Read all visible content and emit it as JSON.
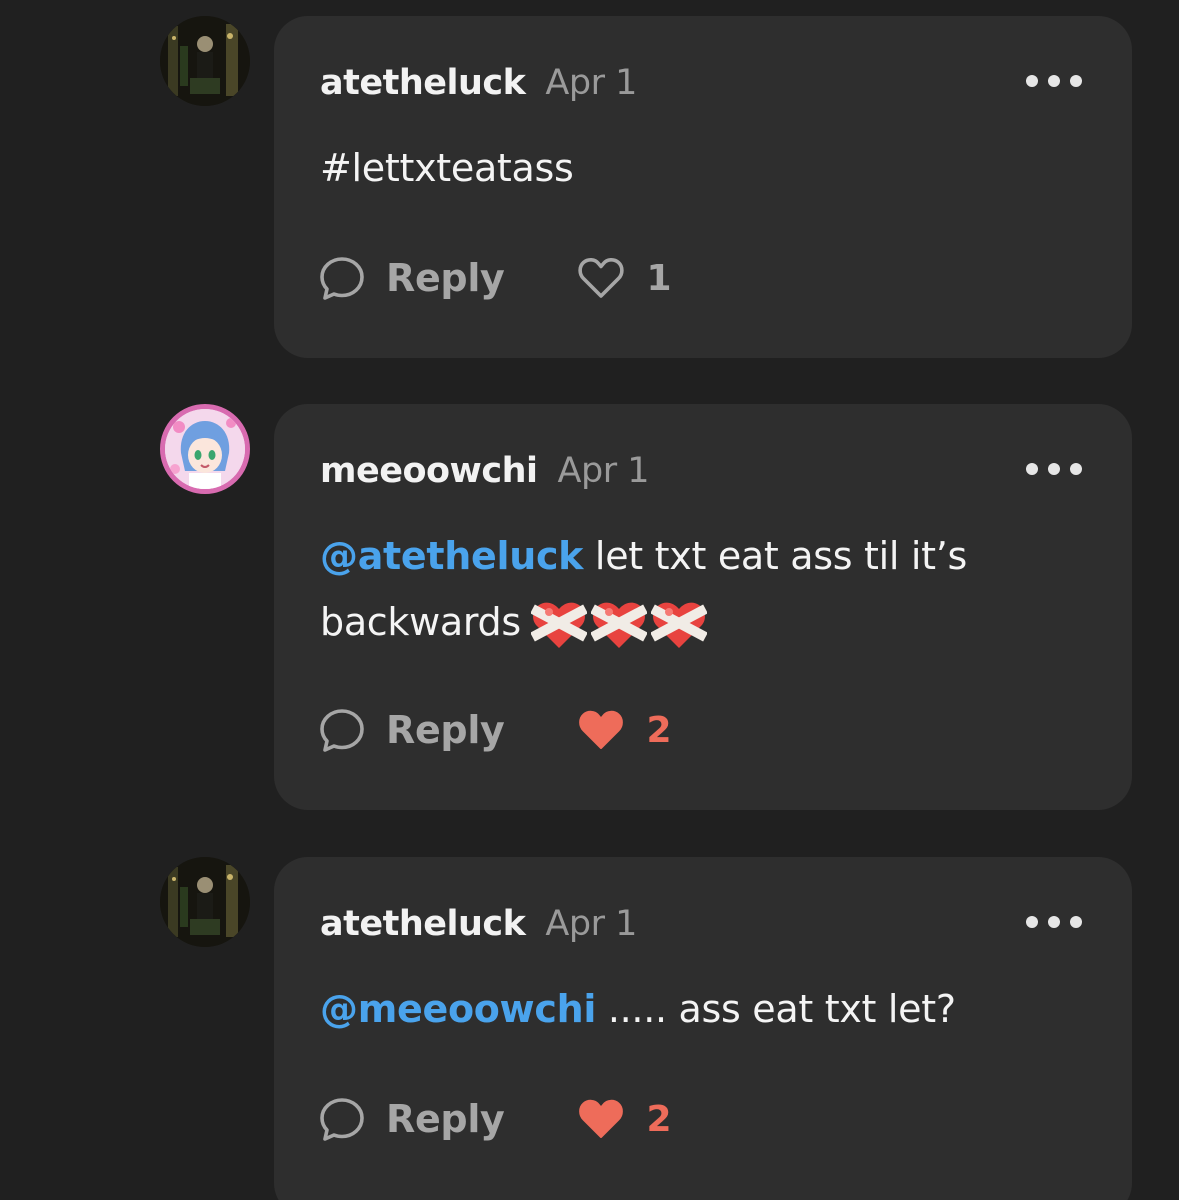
{
  "colors": {
    "background": "#202020",
    "card": "#2e2e2e",
    "mention": "#4aa3ec",
    "liked": "#ee6c5a",
    "muted": "#9a9a9a"
  },
  "comments": [
    {
      "username": "atetheluck",
      "date": "Apr 1",
      "text": "#lettxteatass",
      "reply_label": "Reply",
      "like_count": "1",
      "liked": false,
      "avatar_icon": "avatar-dark-photo"
    },
    {
      "username": "meeoowchi",
      "date": "Apr 1",
      "mention": "@atetheluck",
      "text": " let txt eat ass til it’s backwards",
      "emojis": [
        "mending-heart-emoji",
        "mending-heart-emoji",
        "mending-heart-emoji"
      ],
      "reply_label": "Reply",
      "like_count": "2",
      "liked": true,
      "avatar_icon": "avatar-anime-character"
    },
    {
      "username": "atetheluck",
      "date": "Apr 1",
      "mention": "@meeoowchi",
      "text": " ..... ass eat txt let?",
      "reply_label": "Reply",
      "like_count": "2",
      "liked": true,
      "avatar_icon": "avatar-dark-photo"
    }
  ]
}
